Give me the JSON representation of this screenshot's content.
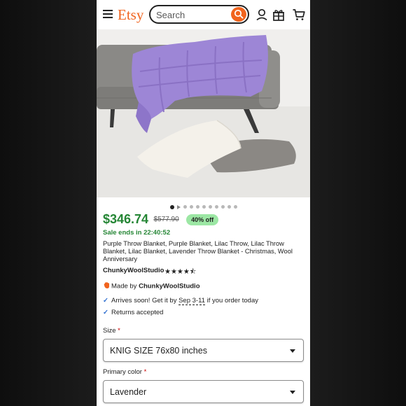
{
  "header": {
    "logo": "Etsy",
    "search_placeholder": "Search",
    "icons": [
      "menu-icon",
      "search-icon",
      "account-icon",
      "gift-icon",
      "cart-icon"
    ]
  },
  "product": {
    "image_alt": "Purple chunky knit throw blanket on a grey sofa with pillows",
    "carousel_count": 11,
    "carousel_active": 1,
    "price": "$346.74",
    "original_price": "$577.90",
    "discount": "40% off",
    "sale_ends": "Sale ends in 22:40:52",
    "title": "Purple Throw Blanket, Purple Blanket, Lilac Throw, Lilac Throw Blanket, Lilac Blanket, Lavender Throw Blanket - Christmas, Wool Anniversary",
    "shop_name": "ChunkyWoolStudio",
    "rating": 4.5,
    "stars_text": "★★★★⯪",
    "made_by_prefix": "Made by ",
    "made_by_shop": "ChunkyWoolStudio",
    "delivery_prefix": "Arrives soon! Get it by ",
    "delivery_date": "Sep 3-11",
    "delivery_suffix": " if you order today",
    "returns": "Returns accepted"
  },
  "options": {
    "size_label": "Size",
    "size_value": "KNIG SIZE 76x80 inches",
    "color_label": "Primary color",
    "color_value": "Lavender",
    "required_mark": "*"
  },
  "colors": {
    "brand": "#f1641e",
    "sale_green": "#258635",
    "discount_bg": "#9ce7a4",
    "blanket": "#9d86d6"
  }
}
